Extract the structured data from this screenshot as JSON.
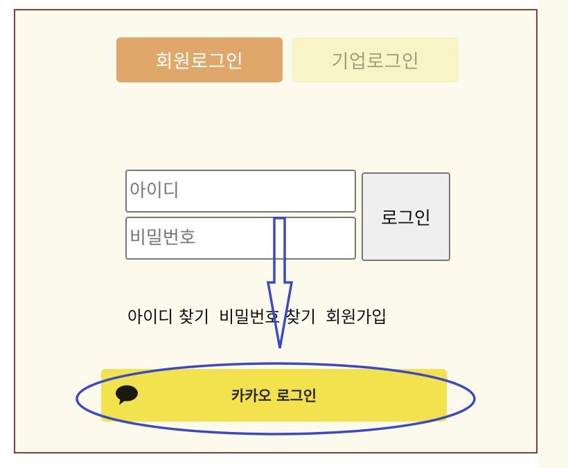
{
  "tabs": {
    "member": "회원로그인",
    "company": "기업로그인"
  },
  "form": {
    "id_placeholder": "아이디",
    "password_placeholder": "비밀번호",
    "login_button": "로그인"
  },
  "links": {
    "find_id": "아이디 찾기",
    "find_password": "비밀번호 찾기",
    "signup": "회원가입"
  },
  "kakao": {
    "label": "카카오 로그인",
    "icon": "speech-bubble-icon",
    "color": "#f2e34e"
  },
  "colors": {
    "active_tab": "#dfa769",
    "inactive_tab": "#f7f4c6",
    "panel_border": "#8b3a36",
    "annotation": "#3b48c8"
  }
}
